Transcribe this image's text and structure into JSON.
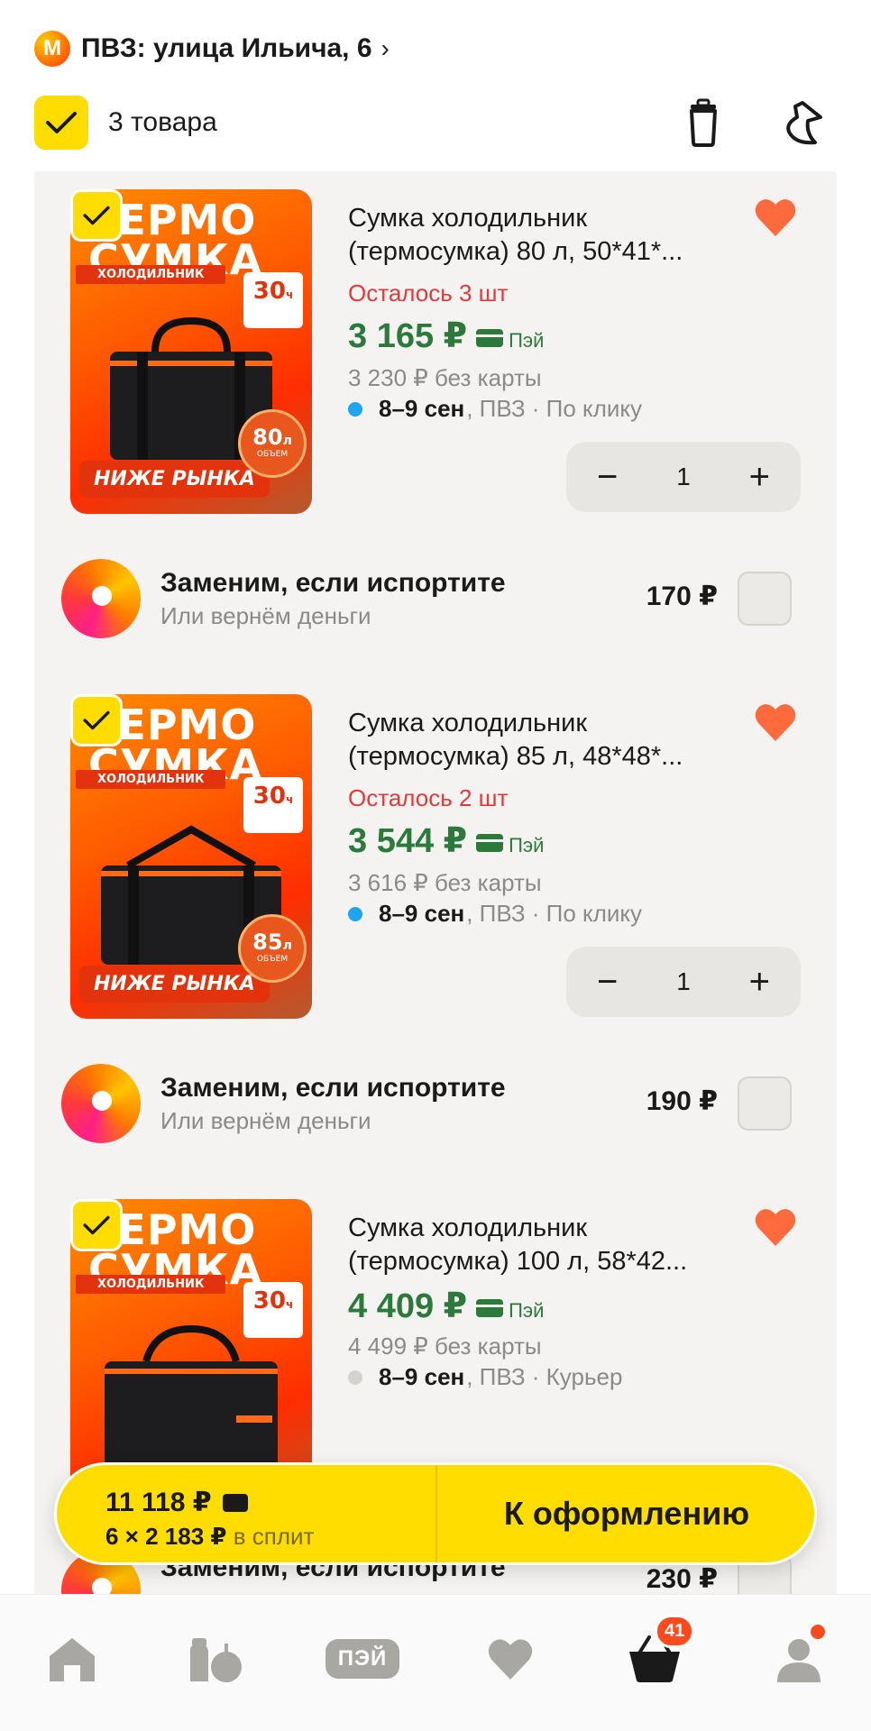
{
  "header": {
    "pvz_logo": "M",
    "pvz_label": "ПВЗ: улица Ильича, 6",
    "select_count": "3 товара"
  },
  "items": [
    {
      "title_line1": "Сумка холодильник",
      "title_line2": "(термосумка) 80 л, 50*41*...",
      "remaining": "Осталось 3 шт",
      "price": "3 165 ₽",
      "pay_label": "Пэй",
      "old_price": "3 230 ₽  без карты",
      "delivery_date": "8–9 сен",
      "delivery_rest": ", ПВЗ · По клику",
      "qty": "1",
      "thumb": {
        "title": "ТЕРМО\nСУМКА",
        "sub": "ХОЛОДИЛЬНИК",
        "badge": "30",
        "badge_unit": "ч",
        "bottom": "НИЖЕ РЫНКА",
        "volume": "80",
        "volume_unit": "л",
        "volume_label": "ОБЪЕМ"
      }
    },
    {
      "title_line1": "Сумка холодильник",
      "title_line2": "(термосумка) 85 л, 48*48*...",
      "remaining": "Осталось 2 шт",
      "price": "3 544 ₽",
      "pay_label": "Пэй",
      "old_price": "3 616 ₽  без карты",
      "delivery_date": "8–9 сен",
      "delivery_rest": ", ПВЗ · По клику",
      "qty": "1",
      "thumb": {
        "title": "ТЕРМО\nСУМКА",
        "sub": "ХОЛОДИЛЬНИК",
        "badge": "30",
        "badge_unit": "ч",
        "bottom": "НИЖЕ РЫНКА",
        "volume": "85",
        "volume_unit": "л",
        "volume_label": "ОБЪЕМ"
      }
    },
    {
      "title_line1": "Сумка холодильник",
      "title_line2": "(термосумка) 100 л, 58*42...",
      "price": "4 409 ₽",
      "pay_label": "Пэй",
      "old_price": "4 499 ₽  без карты",
      "delivery_date": "8–9 сен",
      "delivery_rest": ", ПВЗ · Курьер",
      "thumb": {
        "title": "ТЕРМО\nСУМКА",
        "sub": "ХОЛОДИЛЬНИК",
        "badge": "30",
        "badge_unit": "ч"
      }
    }
  ],
  "insurance": [
    {
      "title": "Заменим, если испортите",
      "subtitle": "Или вернём деньги",
      "price": "170 ₽"
    },
    {
      "title": "Заменим, если испортите",
      "subtitle": "Или вернём деньги",
      "price": "190 ₽"
    },
    {
      "title": "Заменим, если испортите",
      "price": "230 ₽"
    }
  ],
  "checkout": {
    "total": "11 118 ₽",
    "split_amount": "6 × 2 183 ₽",
    "split_label": "в сплит",
    "button_label": "К оформлению"
  },
  "nav": {
    "pay_label": "ПЭЙ",
    "cart_badge": "41"
  },
  "colors": {
    "accent_yellow": "#ffdd00",
    "price_green": "#2b7a3a",
    "remain_red": "#e03a3a",
    "heart": "#ff6a3d"
  },
  "icons": {
    "trash": "trash-icon",
    "share": "share-icon",
    "heart": "heart-icon",
    "home": "home-icon",
    "catalog": "catalog-icon",
    "favorites": "favorites-icon",
    "cart": "cart-icon",
    "profile": "profile-icon"
  }
}
